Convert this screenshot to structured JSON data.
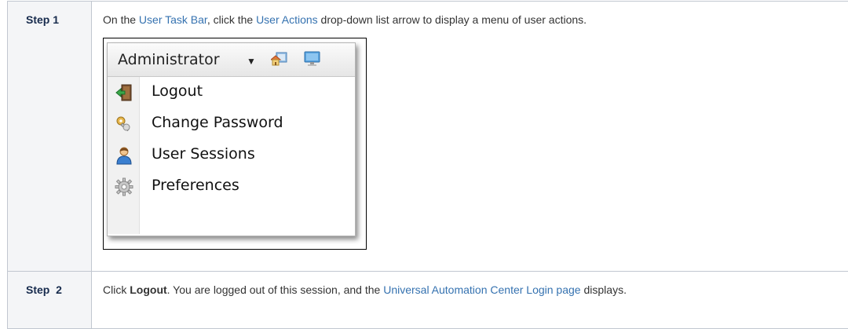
{
  "steps": [
    {
      "label": "Step 1",
      "text_before": "On the ",
      "link1": "User Task Bar",
      "text_middle": ", click the ",
      "link2": "User Actions",
      "text_after": " drop-down list arrow to display a menu of user actions."
    },
    {
      "label": "Step  2",
      "text_before": "Click ",
      "bold": "Logout",
      "text_middle": ". You are logged out of this session, and the ",
      "link": "Universal Automation Center Login page",
      "text_after": " displays."
    }
  ],
  "menu": {
    "user": "Administrator",
    "items": [
      {
        "label": "Logout",
        "icon": "logout-icon"
      },
      {
        "label": "Change Password",
        "icon": "key-icon"
      },
      {
        "label": "User Sessions",
        "icon": "user-icon"
      },
      {
        "label": "Preferences",
        "icon": "gear-icon"
      }
    ],
    "header_icons": [
      "home-icon",
      "monitor-icon"
    ]
  },
  "colors": {
    "link": "#3572b0",
    "label_bg": "#f4f5f7",
    "border": "#c1c7d0"
  }
}
